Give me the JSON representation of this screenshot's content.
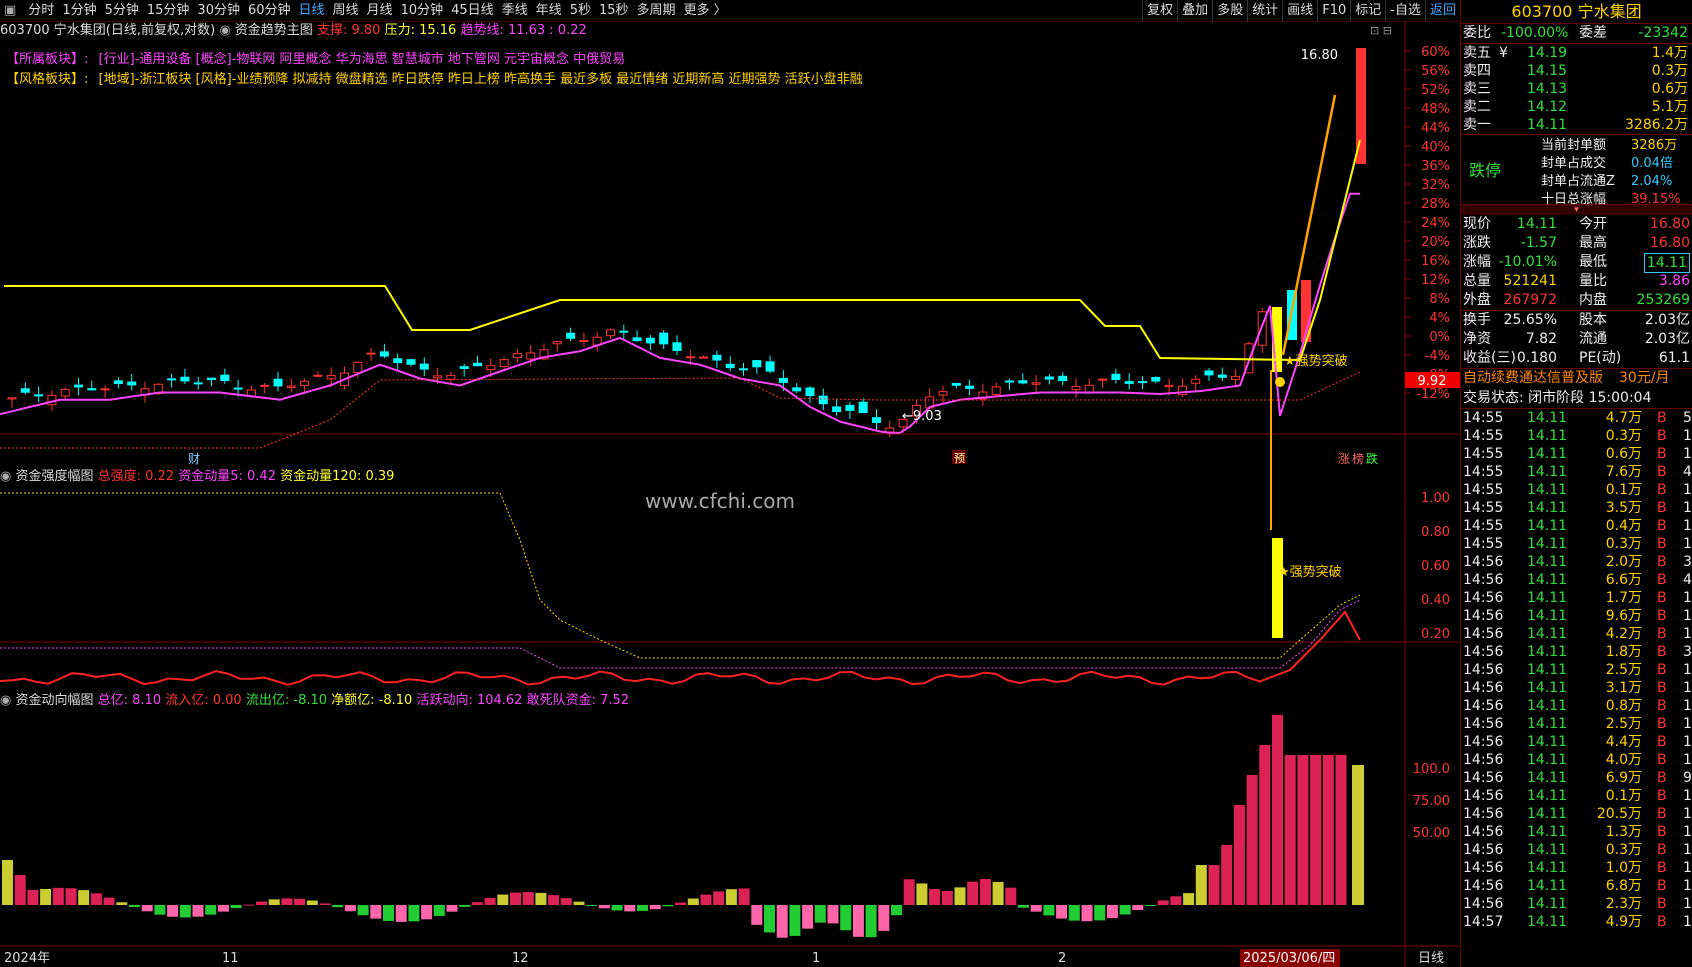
{
  "toolbar": {
    "items": [
      "分时",
      "1分钟",
      "5分钟",
      "15分钟",
      "30分钟",
      "60分钟",
      "日线",
      "周线",
      "月线",
      "10分钟",
      "45日线",
      "季线",
      "年线",
      "5秒",
      "15秒",
      "多周期",
      "更多 〉"
    ],
    "active_index": 6,
    "right_items": [
      "复权",
      "叠加",
      "多股",
      "统计",
      "画线",
      "F10",
      "标记",
      "-自选",
      "返回"
    ]
  },
  "main_panel": {
    "title": "603700 宁水集团(日线,前复权,对数)",
    "indicator": "资金趋势主图",
    "support_label": "支撑: 9.80",
    "pressure_label": "压力: 15.16",
    "trend_label": "趋势线: 11.63 : 0.22",
    "sector_label": "【所属板块】:",
    "sector_text": "[行业]-通用设备 [概念]-物联网 阿里概念 华为海思 智慧城市 地下管网 元宇宙概念 中俄贸易",
    "style_label": "【风格板块】:",
    "style_text": "[地域]-浙江板块 [风格]-业绩预降 拟减持 微盘精选 昨日跌停 昨日上榜 昨高换手 最近多板 最近情绪 近期新高 近期强势 活跃小盘非融",
    "high_label": "16.80",
    "low_label": "←9.03",
    "breakout_label": "★强势突破",
    "price_tag": "9.92",
    "marker_cai": "财",
    "marker_yu": "预",
    "marker_zhang": "涨",
    "marker_bang": "榜",
    "marker_die": "跌",
    "y_ticks": [
      "60%",
      "56%",
      "52%",
      "48%",
      "44%",
      "40%",
      "36%",
      "32%",
      "28%",
      "24%",
      "20%",
      "16%",
      "12%",
      "8%",
      "4%",
      "0%",
      "-4%",
      "-8%",
      "-12%"
    ]
  },
  "strength_panel": {
    "title": "资金强度幅图",
    "total_label": "总强度: 0.22",
    "m5_label": "资金动量5: 0.42",
    "m120_label": "资金动量120: 0.39",
    "breakout_label": "★强势突破",
    "y_ticks": [
      "1.00",
      "0.80",
      "0.60",
      "0.40",
      "0.20"
    ]
  },
  "flow_panel": {
    "title": "资金动向幅图",
    "total_label": "总亿: 8.10",
    "in_label": "流入亿: 0.00",
    "out_label": "流出亿: -8.10",
    "net_label": "净额亿: -8.10",
    "active_label": "活跃动向: 104.62",
    "dare_label": "敢死队资金: 7.52",
    "y_ticks": [
      "100.0",
      "75.00",
      "50.00"
    ]
  },
  "watermark": "www.cfchi.com",
  "x_axis": {
    "labels": [
      "2024年",
      "11",
      "12",
      "1",
      "2"
    ],
    "current_date": "2025/03/06/四",
    "period": "日线"
  },
  "quote": {
    "code": "603700",
    "name": "宁水集团",
    "weibi_label": "委比",
    "weibi": "-100.00%",
    "weicha_label": "委差",
    "weicha": "-23342",
    "asks": [
      {
        "label": "卖五",
        "price": "14.19",
        "vol": "1.4万",
        "mark": "¥"
      },
      {
        "label": "卖四",
        "price": "14.15",
        "vol": "0.3万"
      },
      {
        "label": "卖三",
        "price": "14.13",
        "vol": "0.6万"
      },
      {
        "label": "卖二",
        "price": "14.12",
        "vol": "5.1万"
      },
      {
        "label": "卖一",
        "price": "14.11",
        "vol": "3286.2万"
      }
    ],
    "limit_status": "跌停",
    "seal": [
      {
        "label": "当前封单额",
        "value": "3286万"
      },
      {
        "label": "封单占成交",
        "value": "0.04倍"
      },
      {
        "label": "封单占流通Z",
        "value": "2.04%"
      },
      {
        "label": "十日总涨幅",
        "value": "39.15%"
      }
    ],
    "stats": [
      {
        "l1": "现价",
        "v1": "14.11",
        "l2": "今开",
        "v2": "16.80"
      },
      {
        "l1": "涨跌",
        "v1": "-1.57",
        "l2": "最高",
        "v2": "16.80"
      },
      {
        "l1": "涨幅",
        "v1": "-10.01%",
        "l2": "最低",
        "v2": "14.11"
      },
      {
        "l1": "总量",
        "v1": "521241",
        "l2": "量比",
        "v2": "3.86"
      },
      {
        "l1": "外盘",
        "v1": "267972",
        "l2": "内盘",
        "v2": "253269"
      }
    ],
    "stats2": [
      {
        "l1": "换手",
        "v1": "25.65%",
        "l2": "股本",
        "v2": "2.03亿"
      },
      {
        "l1": "净资",
        "v1": "7.82",
        "l2": "流通",
        "v2": "2.03亿"
      },
      {
        "l1": "收益(三)",
        "v1": "0.180",
        "l2": "PE(动)",
        "v2": "61.1"
      }
    ],
    "ad_text": "自动续费通达信普及版",
    "ad_price": "30元/月",
    "trade_state": "交易状态: 闭市阶段 15:00:04",
    "ticks": [
      {
        "t": "14:55",
        "p": "14.11",
        "v": "4.7万",
        "s": "B",
        "n": "5"
      },
      {
        "t": "14:55",
        "p": "14.11",
        "v": "0.3万",
        "s": "B",
        "n": "1"
      },
      {
        "t": "14:55",
        "p": "14.11",
        "v": "0.6万",
        "s": "B",
        "n": "1"
      },
      {
        "t": "14:55",
        "p": "14.11",
        "v": "7.6万",
        "s": "B",
        "n": "4"
      },
      {
        "t": "14:55",
        "p": "14.11",
        "v": "0.1万",
        "s": "B",
        "n": "1"
      },
      {
        "t": "14:55",
        "p": "14.11",
        "v": "3.5万",
        "s": "B",
        "n": "1"
      },
      {
        "t": "14:55",
        "p": "14.11",
        "v": "0.4万",
        "s": "B",
        "n": "1"
      },
      {
        "t": "14:55",
        "p": "14.11",
        "v": "0.3万",
        "s": "B",
        "n": "1"
      },
      {
        "t": "14:56",
        "p": "14.11",
        "v": "2.0万",
        "s": "B",
        "n": "3"
      },
      {
        "t": "14:56",
        "p": "14.11",
        "v": "6.6万",
        "s": "B",
        "n": "4"
      },
      {
        "t": "14:56",
        "p": "14.11",
        "v": "1.7万",
        "s": "B",
        "n": "1"
      },
      {
        "t": "14:56",
        "p": "14.11",
        "v": "9.6万",
        "s": "B",
        "n": "1"
      },
      {
        "t": "14:56",
        "p": "14.11",
        "v": "4.2万",
        "s": "B",
        "n": "1"
      },
      {
        "t": "14:56",
        "p": "14.11",
        "v": "1.8万",
        "s": "B",
        "n": "3"
      },
      {
        "t": "14:56",
        "p": "14.11",
        "v": "2.5万",
        "s": "B",
        "n": "1"
      },
      {
        "t": "14:56",
        "p": "14.11",
        "v": "3.1万",
        "s": "B",
        "n": "1"
      },
      {
        "t": "14:56",
        "p": "14.11",
        "v": "0.8万",
        "s": "B",
        "n": "1"
      },
      {
        "t": "14:56",
        "p": "14.11",
        "v": "2.5万",
        "s": "B",
        "n": "1"
      },
      {
        "t": "14:56",
        "p": "14.11",
        "v": "4.4万",
        "s": "B",
        "n": "1"
      },
      {
        "t": "14:56",
        "p": "14.11",
        "v": "4.0万",
        "s": "B",
        "n": "1"
      },
      {
        "t": "14:56",
        "p": "14.11",
        "v": "6.9万",
        "s": "B",
        "n": "9"
      },
      {
        "t": "14:56",
        "p": "14.11",
        "v": "0.1万",
        "s": "B",
        "n": "1"
      },
      {
        "t": "14:56",
        "p": "14.11",
        "v": "20.5万",
        "s": "B",
        "n": "1"
      },
      {
        "t": "14:56",
        "p": "14.11",
        "v": "1.3万",
        "s": "B",
        "n": "1"
      },
      {
        "t": "14:56",
        "p": "14.11",
        "v": "0.3万",
        "s": "B",
        "n": "1"
      },
      {
        "t": "14:56",
        "p": "14.11",
        "v": "1.0万",
        "s": "B",
        "n": "1"
      },
      {
        "t": "14:56",
        "p": "14.11",
        "v": "6.8万",
        "s": "B",
        "n": "1"
      },
      {
        "t": "14:56",
        "p": "14.11",
        "v": "2.3万",
        "s": "B",
        "n": "1"
      },
      {
        "t": "14:57",
        "p": "14.11",
        "v": "4.9万",
        "s": "B",
        "n": "1"
      }
    ]
  },
  "colors": {
    "up": "#ff3333",
    "down": "#00ffff",
    "ma": "#ff44ff",
    "trend": "#ffff00",
    "support": "#ff3333"
  },
  "chart_data": [
    {
      "type": "candlestick",
      "title": "603700 宁水集团(日线,前复权,对数)",
      "y_range_pct": [
        -12,
        60
      ],
      "annotations": {
        "high": 16.8,
        "low": 9.03,
        "last_close": 14.11,
        "support": 9.8,
        "pressure": 15.16
      }
    },
    {
      "type": "line",
      "title": "资金强度幅图",
      "y_range": [
        0,
        1.1
      ],
      "series": [
        {
          "name": "总强度",
          "last": 0.22
        },
        {
          "name": "资金动量5",
          "last": 0.42
        },
        {
          "name": "资金动量120",
          "last": 0.39
        }
      ]
    },
    {
      "type": "bar",
      "title": "资金动向幅图",
      "series": [
        {
          "name": "活跃动向",
          "last": 104.62
        },
        {
          "name": "敢死队资金",
          "last": 7.52
        }
      ]
    }
  ]
}
